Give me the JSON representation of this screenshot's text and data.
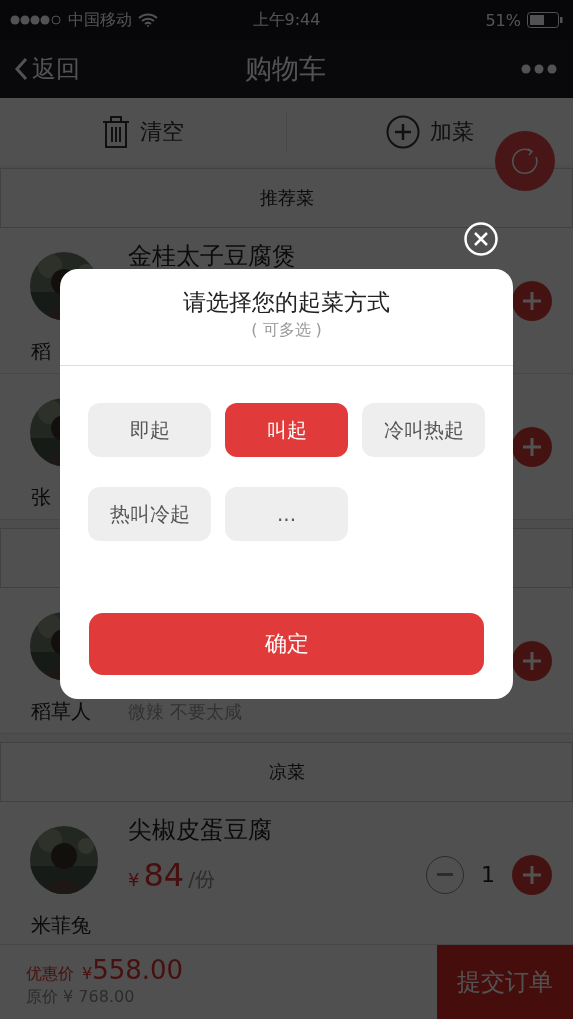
{
  "status_bar": {
    "carrier": "中国移动",
    "time": "上午9:44",
    "battery_text": "51%"
  },
  "nav": {
    "back": "返回",
    "title": "购物车"
  },
  "actions": [
    {
      "kind": "trash",
      "label": "清空"
    },
    {
      "kind": "add",
      "label": "加菜"
    }
  ],
  "sections": [
    {
      "title": "推荐菜",
      "rows": [
        {
          "person": "稻",
          "dish": "金桂太子豆腐煲"
        },
        {
          "person": "张"
        }
      ]
    },
    {
      "rows": [
        {
          "person": "稻草人",
          "note": "微辣 不要太咸"
        }
      ]
    },
    {
      "title": "凉菜",
      "rows": [
        {
          "person": "米菲兔",
          "dish": "尖椒皮蛋豆腐",
          "currency": "¥",
          "price": "84",
          "unit": "/份",
          "quantity": "1"
        }
      ]
    }
  ],
  "footer": {
    "discount_label": "优惠价",
    "discount_currency": "¥",
    "discount_price": "558.00",
    "original": "原价 ¥ 768.00",
    "submit": "提交订单"
  },
  "dialog": {
    "title": "请选择您的起菜方式",
    "subtitle": "( 可多选 )",
    "options": [
      {
        "label": "即起",
        "selected": false
      },
      {
        "label": "叫起",
        "selected": true
      },
      {
        "label": "冷叫热起",
        "selected": false
      },
      {
        "label": "热叫冷起",
        "selected": false
      },
      {
        "label": "...",
        "selected": false
      }
    ],
    "confirm": "确定"
  }
}
